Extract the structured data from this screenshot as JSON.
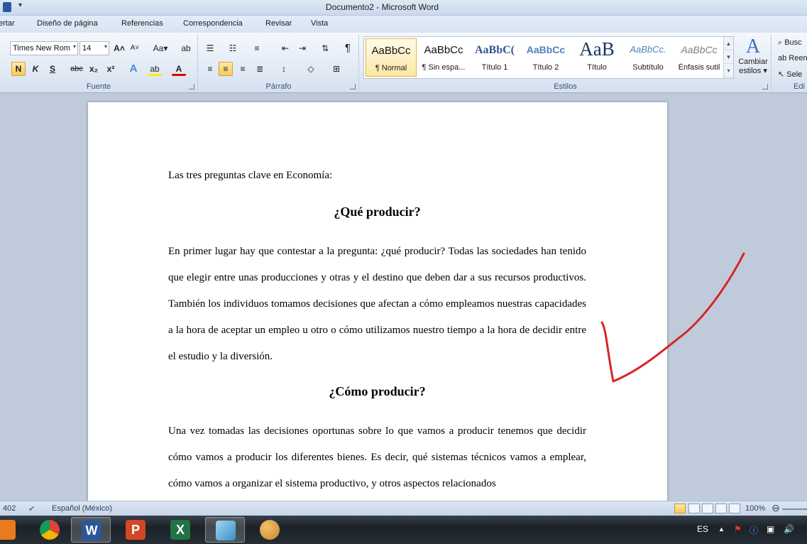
{
  "window": {
    "title": "Documento2 - Microsoft Word"
  },
  "tabs": [
    "ertar",
    "Diseño de página",
    "Referencias",
    "Correspondencia",
    "Revisar",
    "Vista"
  ],
  "ribbon": {
    "font": {
      "group_label": "Fuente",
      "font_name": "Times New Rom",
      "font_size": "14",
      "grow_label": "A",
      "shrink_label": "A",
      "case_label": "Aa",
      "bold": "N",
      "italic": "K",
      "underline": "S",
      "strike": "abc",
      "subscript": "x₂",
      "superscript": "x²",
      "effects": "A",
      "highlight": "ab",
      "font_color": "A"
    },
    "paragraph": {
      "group_label": "Párrafo",
      "pilcrow": "¶"
    },
    "styles": {
      "group_label": "Estilos",
      "items": [
        {
          "preview": "AaBbCc",
          "name": "¶ Normal"
        },
        {
          "preview": "AaBbCc",
          "name": "¶ Sin espa..."
        },
        {
          "preview": "AaBbC(",
          "name": "Título 1"
        },
        {
          "preview": "AaBbCc",
          "name": "Título 2"
        },
        {
          "preview": "AaB",
          "name": "Título"
        },
        {
          "preview": "AaBbCc.",
          "name": "Subtítulo"
        },
        {
          "preview": "AaBbCc",
          "name": "Énfasis sutil"
        }
      ],
      "change_label_1": "Cambiar",
      "change_label_2": "estilos ▾"
    },
    "editing": {
      "group_label": "Edi",
      "find": "Busc",
      "replace": "Reen",
      "select": "Sele"
    }
  },
  "document": {
    "intro": "Las tres preguntas clave en Economía:",
    "heading1": "¿Qué producir?",
    "para1": "En primer lugar hay que contestar a la pregunta: ¿qué producir? Todas las sociedades han tenido que elegir entre unas producciones y otras y el destino que deben dar a sus recursos productivos. También los individuos tomamos decisiones que afectan a cómo empleamos nuestras capacidades a la hora de aceptar un empleo u otro o cómo utilizamos nuestro tiempo a la hora de decidir entre el estudio y la diversión.",
    "heading2": "¿Cómo producir?",
    "para2": "Una vez tomadas las decisiones oportunas sobre lo que vamos a producir tenemos que decidir cómo vamos a producir los diferentes bienes. Es decir, qué sistemas técnicos vamos a emplear, cómo vamos a organizar el sistema productivo, y otros aspectos relacionados"
  },
  "status": {
    "words": "402",
    "language": "Español (México)",
    "zoom": "100%"
  },
  "taskbar": {
    "lang": "ES",
    "colors": {
      "chrome": "#db4437",
      "word": "#2b579a",
      "ppt": "#d24726",
      "excel": "#217346"
    }
  }
}
